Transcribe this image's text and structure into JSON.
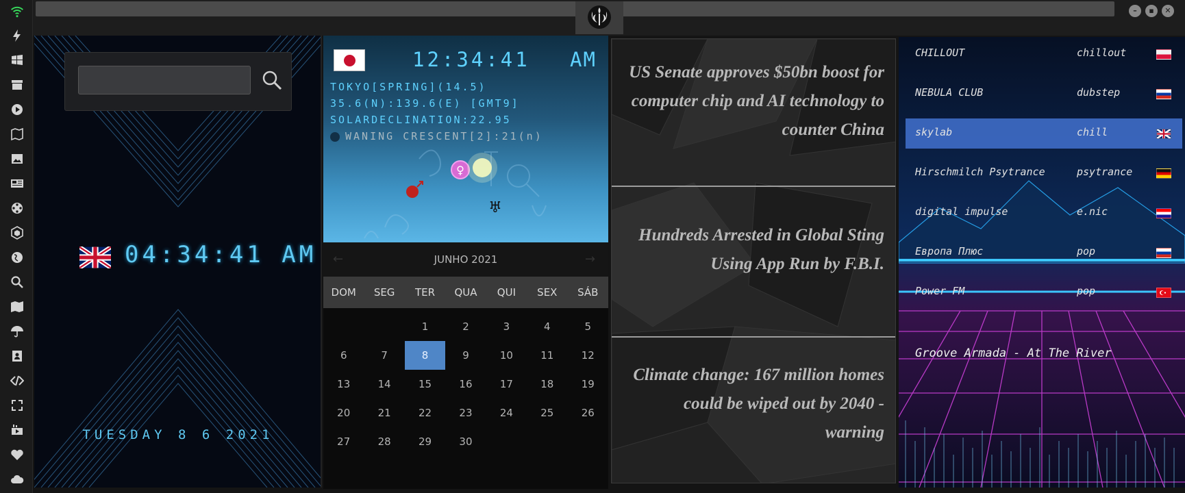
{
  "rail": {
    "icons": [
      "wifi-icon",
      "bolt-icon",
      "windows-icon",
      "archive-icon",
      "play-icon",
      "map-book-icon",
      "image-icon",
      "news-icon",
      "film-reel-icon",
      "hexagon-icon",
      "globe-icon",
      "search-icon",
      "map-icon",
      "umbrella-icon",
      "contacts-icon",
      "code-icon",
      "fullscreen-icon",
      "youtube-icon",
      "heart-icon",
      "cloud-icon"
    ]
  },
  "clock": {
    "search_placeholder": "",
    "time": "04:34:41 AM",
    "date": "TUESDAY 8 6 2021"
  },
  "world": {
    "time": "12:34:41",
    "ampm": "AM",
    "location": "TOKYO[SPRING](14.5)",
    "coords": "35.6(N):139.6(E) [GMT9]",
    "declination": "SOLARDECLINATION:22.95",
    "moon": "WANING CRESCENT[2]:21(n)"
  },
  "calendar": {
    "title": "JUNHO 2021",
    "days_of_week": [
      "DOM",
      "SEG",
      "TER",
      "QUA",
      "QUI",
      "SEX",
      "SÁB"
    ],
    "weeks": [
      [
        "",
        "",
        "1",
        "2",
        "3",
        "4",
        "5"
      ],
      [
        "6",
        "7",
        "8",
        "9",
        "10",
        "11",
        "12"
      ],
      [
        "13",
        "14",
        "15",
        "16",
        "17",
        "18",
        "19"
      ],
      [
        "20",
        "21",
        "22",
        "23",
        "24",
        "25",
        "26"
      ],
      [
        "27",
        "28",
        "29",
        "30",
        "",
        "",
        ""
      ]
    ],
    "today": "8"
  },
  "news": [
    "US Senate approves $50bn boost for computer chip and AI technology to counter China",
    "Hundreds Arrested in Global Sting Using App Run by F.B.I.",
    "Climate change: 167 million homes could be wiped out by 2040 - warning"
  ],
  "radio": {
    "stations": [
      {
        "name": "CHILLOUT",
        "genre": "chillout",
        "flag": "poland"
      },
      {
        "name": "NEBULA CLUB",
        "genre": "dubstep",
        "flag": "russia"
      },
      {
        "name": "skylab",
        "genre": "chill",
        "flag": "uk"
      },
      {
        "name": "Hirschmilch Psytrance",
        "genre": "psytrance",
        "flag": "germany"
      },
      {
        "name": "digital impulse",
        "genre": "e.nic",
        "flag": "croatia"
      },
      {
        "name": "Европа Плюс",
        "genre": "pop",
        "flag": "russia"
      },
      {
        "name": "Power FM",
        "genre": "pop",
        "flag": "turkey"
      }
    ],
    "selected_index": 2,
    "now_playing": "Groove Armada - At The River"
  },
  "colors": {
    "accent_cyan": "#5fc9f2",
    "calendar_today": "#4f86c7",
    "station_selected": "#4678dc"
  }
}
